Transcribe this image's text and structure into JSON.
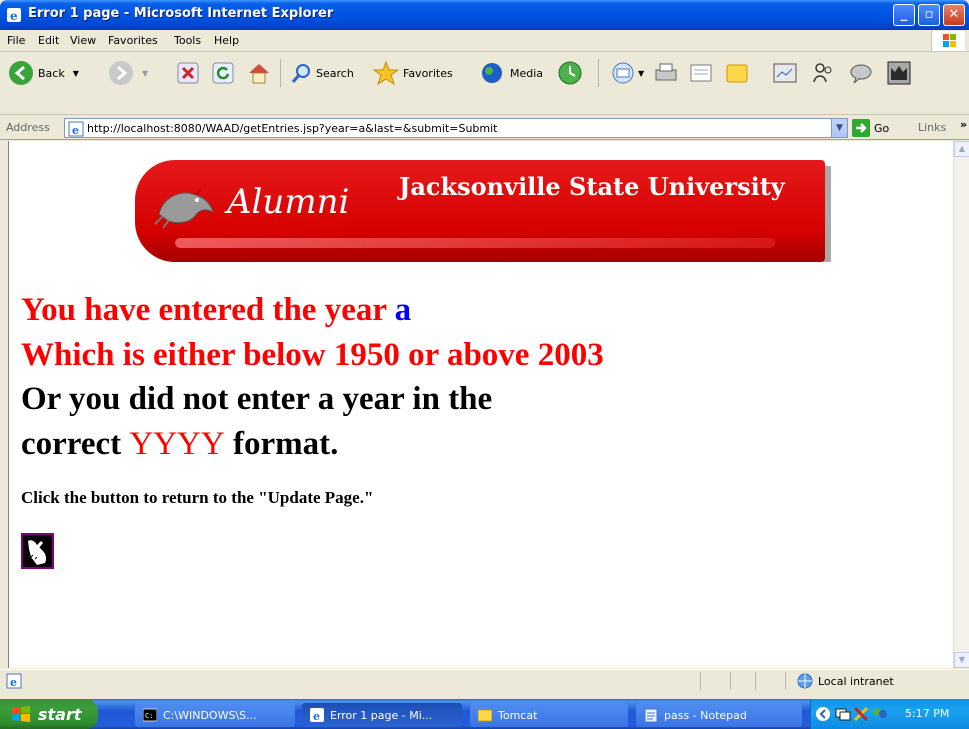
{
  "window": {
    "title": "Error 1 page - Microsoft Internet Explorer"
  },
  "menu": [
    "File",
    "Edit",
    "View",
    "Favorites",
    "Tools",
    "Help"
  ],
  "toolbar": {
    "back_label": "Back",
    "search_label": "Search",
    "favorites_label": "Favorites",
    "media_label": "Media"
  },
  "address": {
    "label": "Address",
    "url": "http://localhost:8080/WAAD/getEntries.jsp?year=a&last=&submit=Submit",
    "go_label": "Go",
    "links_label": "Links"
  },
  "banner": {
    "alumni": "Alumni",
    "university": "Jacksonville State University"
  },
  "message": {
    "line1_prefix": "You have entered the year",
    "entered_year": "a",
    "line2": "Which is either below 1950 or above 2003",
    "line3": "Or you did not enter a year in the",
    "line4_prefix": "correct",
    "format": "YYYY",
    "line4_suffix": "format.",
    "instruction": "Click the button to return to the \"Update Page.\""
  },
  "status": {
    "zone": "Local intranet"
  },
  "taskbar": {
    "start_label": "start",
    "tasks": [
      {
        "label": "C:\\WINDOWS\\S..."
      },
      {
        "label": "Error 1 page - Mi..."
      },
      {
        "label": "Tomcat"
      },
      {
        "label": "pass - Notepad"
      }
    ],
    "clock": "5:17 PM"
  }
}
